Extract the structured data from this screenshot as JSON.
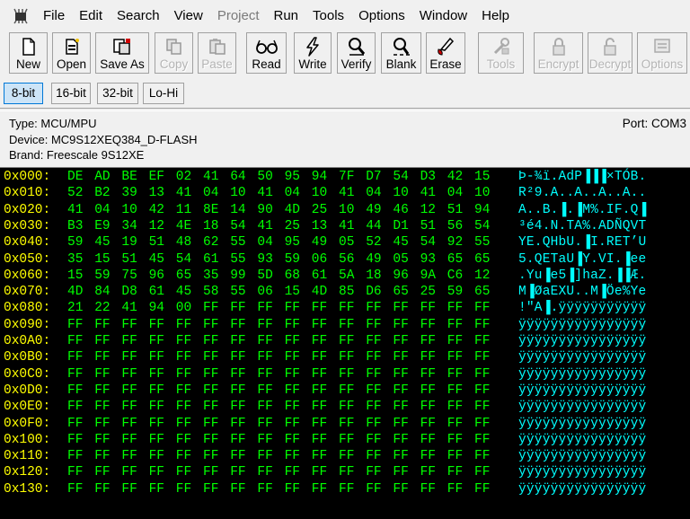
{
  "menubar": {
    "items": [
      {
        "label": "File",
        "enabled": true
      },
      {
        "label": "Edit",
        "enabled": true
      },
      {
        "label": "Search",
        "enabled": true
      },
      {
        "label": "View",
        "enabled": true
      },
      {
        "label": "Project",
        "enabled": false
      },
      {
        "label": "Run",
        "enabled": true
      },
      {
        "label": "Tools",
        "enabled": true
      },
      {
        "label": "Options",
        "enabled": true
      },
      {
        "label": "Window",
        "enabled": true
      },
      {
        "label": "Help",
        "enabled": true
      }
    ]
  },
  "toolbar": {
    "buttons": [
      {
        "label": "New",
        "icon": "new-file-icon",
        "enabled": true
      },
      {
        "label": "Open",
        "icon": "open-file-icon",
        "enabled": true
      },
      {
        "label": "Save As",
        "icon": "save-as-icon",
        "enabled": true
      },
      {
        "label": "Copy",
        "icon": "copy-icon",
        "enabled": false
      },
      {
        "label": "Paste",
        "icon": "paste-icon",
        "enabled": false
      },
      {
        "label": "Read",
        "icon": "read-glasses-icon",
        "enabled": true
      },
      {
        "label": "Write",
        "icon": "write-lightning-icon",
        "enabled": true
      },
      {
        "label": "Verify",
        "icon": "verify-magnifier-icon",
        "enabled": true
      },
      {
        "label": "Blank",
        "icon": "blank-check-icon",
        "enabled": true
      },
      {
        "label": "Erase",
        "icon": "erase-icon",
        "enabled": true
      },
      {
        "label": "Tools",
        "icon": "tools-icon",
        "enabled": false
      },
      {
        "label": "Encrypt",
        "icon": "encrypt-lock-icon",
        "enabled": false
      },
      {
        "label": "Decrypt",
        "icon": "decrypt-lock-icon",
        "enabled": false
      },
      {
        "label": "Options",
        "icon": "options-icon",
        "enabled": false
      }
    ]
  },
  "view_modes": [
    {
      "label": "8-bit",
      "active": true
    },
    {
      "label": "16-bit",
      "active": false
    },
    {
      "label": "32-bit",
      "active": false
    },
    {
      "label": "Lo-Hi",
      "active": false
    }
  ],
  "device_info": {
    "type": "Type: MCU/MPU",
    "device": "Device: MC9S12XEQ384_D-FLASH",
    "brand": "Brand: Freescale 9S12XE",
    "port": "Port: COM3"
  },
  "colors": {
    "address": "#ffff00",
    "bytes": "#00ff00",
    "ascii": "#00ffff",
    "background": "#000000",
    "active_mode": "#cce4f7"
  },
  "hex_rows": [
    {
      "address": "0x000:",
      "bytes": [
        "DE",
        "AD",
        "BE",
        "EF",
        "02",
        "41",
        "64",
        "50",
        "95",
        "94",
        "7F",
        "D7",
        "54",
        "D3",
        "42",
        "15"
      ],
      "ascii": "Þ-¾ï.AdP▐▐▐×TÓB."
    },
    {
      "address": "0x010:",
      "bytes": [
        "52",
        "B2",
        "39",
        "13",
        "41",
        "04",
        "10",
        "41",
        "04",
        "10",
        "41",
        "04",
        "10",
        "41",
        "04",
        "10"
      ],
      "ascii": "R²9.A..A..A..A.."
    },
    {
      "address": "0x020:",
      "bytes": [
        "41",
        "04",
        "10",
        "42",
        "11",
        "8E",
        "14",
        "90",
        "4D",
        "25",
        "10",
        "49",
        "46",
        "12",
        "51",
        "94"
      ],
      "ascii": "A..B.▐.▐M%.IF.Q▐"
    },
    {
      "address": "0x030:",
      "bytes": [
        "B3",
        "E9",
        "34",
        "12",
        "4E",
        "18",
        "54",
        "41",
        "25",
        "13",
        "41",
        "44",
        "D1",
        "51",
        "56",
        "54"
      ],
      "ascii": "³é4.N.TA%.ADÑQVT"
    },
    {
      "address": "0x040:",
      "bytes": [
        "59",
        "45",
        "19",
        "51",
        "48",
        "62",
        "55",
        "04",
        "95",
        "49",
        "05",
        "52",
        "45",
        "54",
        "92",
        "55"
      ],
      "ascii": "YE.QHbU.▐I.RET’U"
    },
    {
      "address": "0x050:",
      "bytes": [
        "35",
        "15",
        "51",
        "45",
        "54",
        "61",
        "55",
        "93",
        "59",
        "06",
        "56",
        "49",
        "05",
        "93",
        "65",
        "65"
      ],
      "ascii": "5.QETaU▐Y.VI.▐ee"
    },
    {
      "address": "0x060:",
      "bytes": [
        "15",
        "59",
        "75",
        "96",
        "65",
        "35",
        "99",
        "5D",
        "68",
        "61",
        "5A",
        "18",
        "96",
        "9A",
        "C6",
        "12"
      ],
      "ascii": ".Yu▐e5▐]haZ.▐▐Æ."
    },
    {
      "address": "0x070:",
      "bytes": [
        "4D",
        "84",
        "D8",
        "61",
        "45",
        "58",
        "55",
        "06",
        "15",
        "4D",
        "85",
        "D6",
        "65",
        "25",
        "59",
        "65"
      ],
      "ascii": "M▐ØaEXU..M▐Öe%Ye"
    },
    {
      "address": "0x080:",
      "bytes": [
        "21",
        "22",
        "41",
        "94",
        "00",
        "FF",
        "FF",
        "FF",
        "FF",
        "FF",
        "FF",
        "FF",
        "FF",
        "FF",
        "FF",
        "FF"
      ],
      "ascii": "!\"A▐.ÿÿÿÿÿÿÿÿÿÿÿ"
    },
    {
      "address": "0x090:",
      "bytes": [
        "FF",
        "FF",
        "FF",
        "FF",
        "FF",
        "FF",
        "FF",
        "FF",
        "FF",
        "FF",
        "FF",
        "FF",
        "FF",
        "FF",
        "FF",
        "FF"
      ],
      "ascii": "ÿÿÿÿÿÿÿÿÿÿÿÿÿÿÿÿ"
    },
    {
      "address": "0x0A0:",
      "bytes": [
        "FF",
        "FF",
        "FF",
        "FF",
        "FF",
        "FF",
        "FF",
        "FF",
        "FF",
        "FF",
        "FF",
        "FF",
        "FF",
        "FF",
        "FF",
        "FF"
      ],
      "ascii": "ÿÿÿÿÿÿÿÿÿÿÿÿÿÿÿÿ"
    },
    {
      "address": "0x0B0:",
      "bytes": [
        "FF",
        "FF",
        "FF",
        "FF",
        "FF",
        "FF",
        "FF",
        "FF",
        "FF",
        "FF",
        "FF",
        "FF",
        "FF",
        "FF",
        "FF",
        "FF"
      ],
      "ascii": "ÿÿÿÿÿÿÿÿÿÿÿÿÿÿÿÿ"
    },
    {
      "address": "0x0C0:",
      "bytes": [
        "FF",
        "FF",
        "FF",
        "FF",
        "FF",
        "FF",
        "FF",
        "FF",
        "FF",
        "FF",
        "FF",
        "FF",
        "FF",
        "FF",
        "FF",
        "FF"
      ],
      "ascii": "ÿÿÿÿÿÿÿÿÿÿÿÿÿÿÿÿ"
    },
    {
      "address": "0x0D0:",
      "bytes": [
        "FF",
        "FF",
        "FF",
        "FF",
        "FF",
        "FF",
        "FF",
        "FF",
        "FF",
        "FF",
        "FF",
        "FF",
        "FF",
        "FF",
        "FF",
        "FF"
      ],
      "ascii": "ÿÿÿÿÿÿÿÿÿÿÿÿÿÿÿÿ"
    },
    {
      "address": "0x0E0:",
      "bytes": [
        "FF",
        "FF",
        "FF",
        "FF",
        "FF",
        "FF",
        "FF",
        "FF",
        "FF",
        "FF",
        "FF",
        "FF",
        "FF",
        "FF",
        "FF",
        "FF"
      ],
      "ascii": "ÿÿÿÿÿÿÿÿÿÿÿÿÿÿÿÿ"
    },
    {
      "address": "0x0F0:",
      "bytes": [
        "FF",
        "FF",
        "FF",
        "FF",
        "FF",
        "FF",
        "FF",
        "FF",
        "FF",
        "FF",
        "FF",
        "FF",
        "FF",
        "FF",
        "FF",
        "FF"
      ],
      "ascii": "ÿÿÿÿÿÿÿÿÿÿÿÿÿÿÿÿ"
    },
    {
      "address": "0x100:",
      "bytes": [
        "FF",
        "FF",
        "FF",
        "FF",
        "FF",
        "FF",
        "FF",
        "FF",
        "FF",
        "FF",
        "FF",
        "FF",
        "FF",
        "FF",
        "FF",
        "FF"
      ],
      "ascii": "ÿÿÿÿÿÿÿÿÿÿÿÿÿÿÿÿ"
    },
    {
      "address": "0x110:",
      "bytes": [
        "FF",
        "FF",
        "FF",
        "FF",
        "FF",
        "FF",
        "FF",
        "FF",
        "FF",
        "FF",
        "FF",
        "FF",
        "FF",
        "FF",
        "FF",
        "FF"
      ],
      "ascii": "ÿÿÿÿÿÿÿÿÿÿÿÿÿÿÿÿ"
    },
    {
      "address": "0x120:",
      "bytes": [
        "FF",
        "FF",
        "FF",
        "FF",
        "FF",
        "FF",
        "FF",
        "FF",
        "FF",
        "FF",
        "FF",
        "FF",
        "FF",
        "FF",
        "FF",
        "FF"
      ],
      "ascii": "ÿÿÿÿÿÿÿÿÿÿÿÿÿÿÿÿ"
    },
    {
      "address": "0x130:",
      "bytes": [
        "FF",
        "FF",
        "FF",
        "FF",
        "FF",
        "FF",
        "FF",
        "FF",
        "FF",
        "FF",
        "FF",
        "FF",
        "FF",
        "FF",
        "FF",
        "FF"
      ],
      "ascii": "ÿÿÿÿÿÿÿÿÿÿÿÿÿÿÿÿ"
    }
  ]
}
